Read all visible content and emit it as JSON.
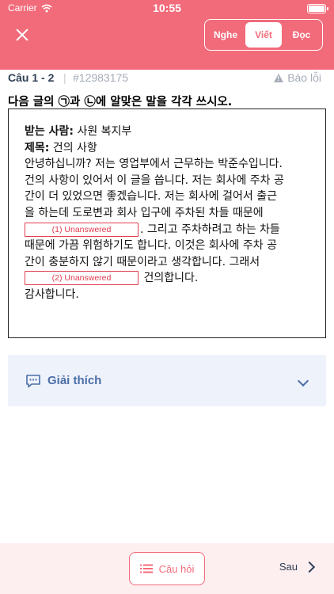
{
  "status_bar": {
    "carrier": "Carrier",
    "time": "10:55"
  },
  "header": {
    "tabs": [
      {
        "label": "Nghe",
        "active": false
      },
      {
        "label": "Viết",
        "active": true
      },
      {
        "label": "Đọc",
        "active": false
      }
    ]
  },
  "question": {
    "number": "Câu 1 - 2",
    "separator": "|",
    "id": "#12983175",
    "report_label": "Báo lỗi",
    "instruction": "다음 글의 ㉠과 ㉡에 알맞은 말을 각각 쓰시오."
  },
  "passage": {
    "recipient_label": "받는 사람:",
    "recipient": " 사원 복지부",
    "subject_label": "제목:",
    "subject": " 건의 사항",
    "lines": [
      "안녕하십니까? 저는 영업부에서 근무하는 박준수입니다.",
      "건의 사항이 있어서 이 글을 씁니다. 저는 회사에 주차 공",
      "간이 더 있었으면 좋겠습니다. 저는 회사에 걸어서 출근",
      "을 하는데 도로변과 회사 입구에 주차된 차들 때문에"
    ],
    "blank1": "(1) Unanswered",
    "after_blank1": ". 그리고 주차하려고 하는 차들",
    "line6": "때문에 가끔 위험하기도 합니다. 이것은 회사에 주차 공",
    "line7": "간이 충분하지 않기 때문이라고 생각합니다. 그래서",
    "blank2": "(2) Unanswered",
    "after_blank2": " 건의합니다.",
    "closing": "감사합니다."
  },
  "explanation": {
    "label": "Giải thích"
  },
  "footer": {
    "questions_label": "Câu hỏi",
    "next_label": "Sau"
  },
  "colors": {
    "accent": "#f26b7a",
    "blank": "#e23b4f",
    "explain_text": "#4b6ea8",
    "explain_bg": "#eef2fa"
  }
}
